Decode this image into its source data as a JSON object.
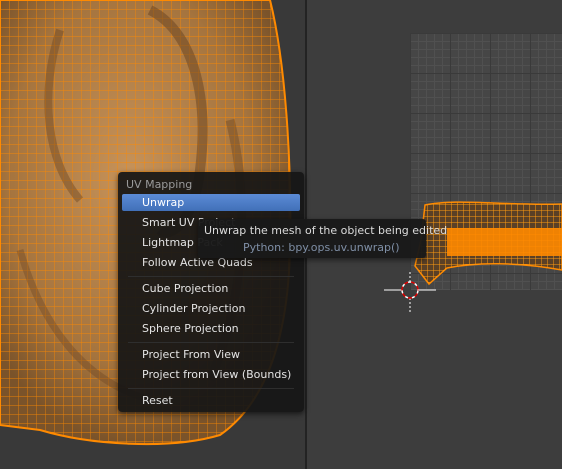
{
  "menu": {
    "title": "UV Mapping",
    "items": [
      {
        "label": "Unwrap",
        "active": true
      },
      {
        "label": "Smart UV Project"
      },
      {
        "label": "Lightmap Pack"
      },
      {
        "label": "Follow Active Quads"
      },
      {
        "label": "Cube Projection"
      },
      {
        "label": "Cylinder Projection"
      },
      {
        "label": "Sphere Projection"
      },
      {
        "label": "Project From View"
      },
      {
        "label": "Project from View (Bounds)"
      },
      {
        "label": "Reset"
      }
    ]
  },
  "tooltip": {
    "description": "Unwrap the mesh of the object being edited",
    "python": "Python: bpy.ops.uv.unwrap()"
  },
  "colors": {
    "mesh_fill": "#b8844a",
    "mesh_wire": "#ff8a00",
    "highlight": "#5680c2"
  },
  "icons": {
    "cursor": "3d-cursor-icon"
  }
}
